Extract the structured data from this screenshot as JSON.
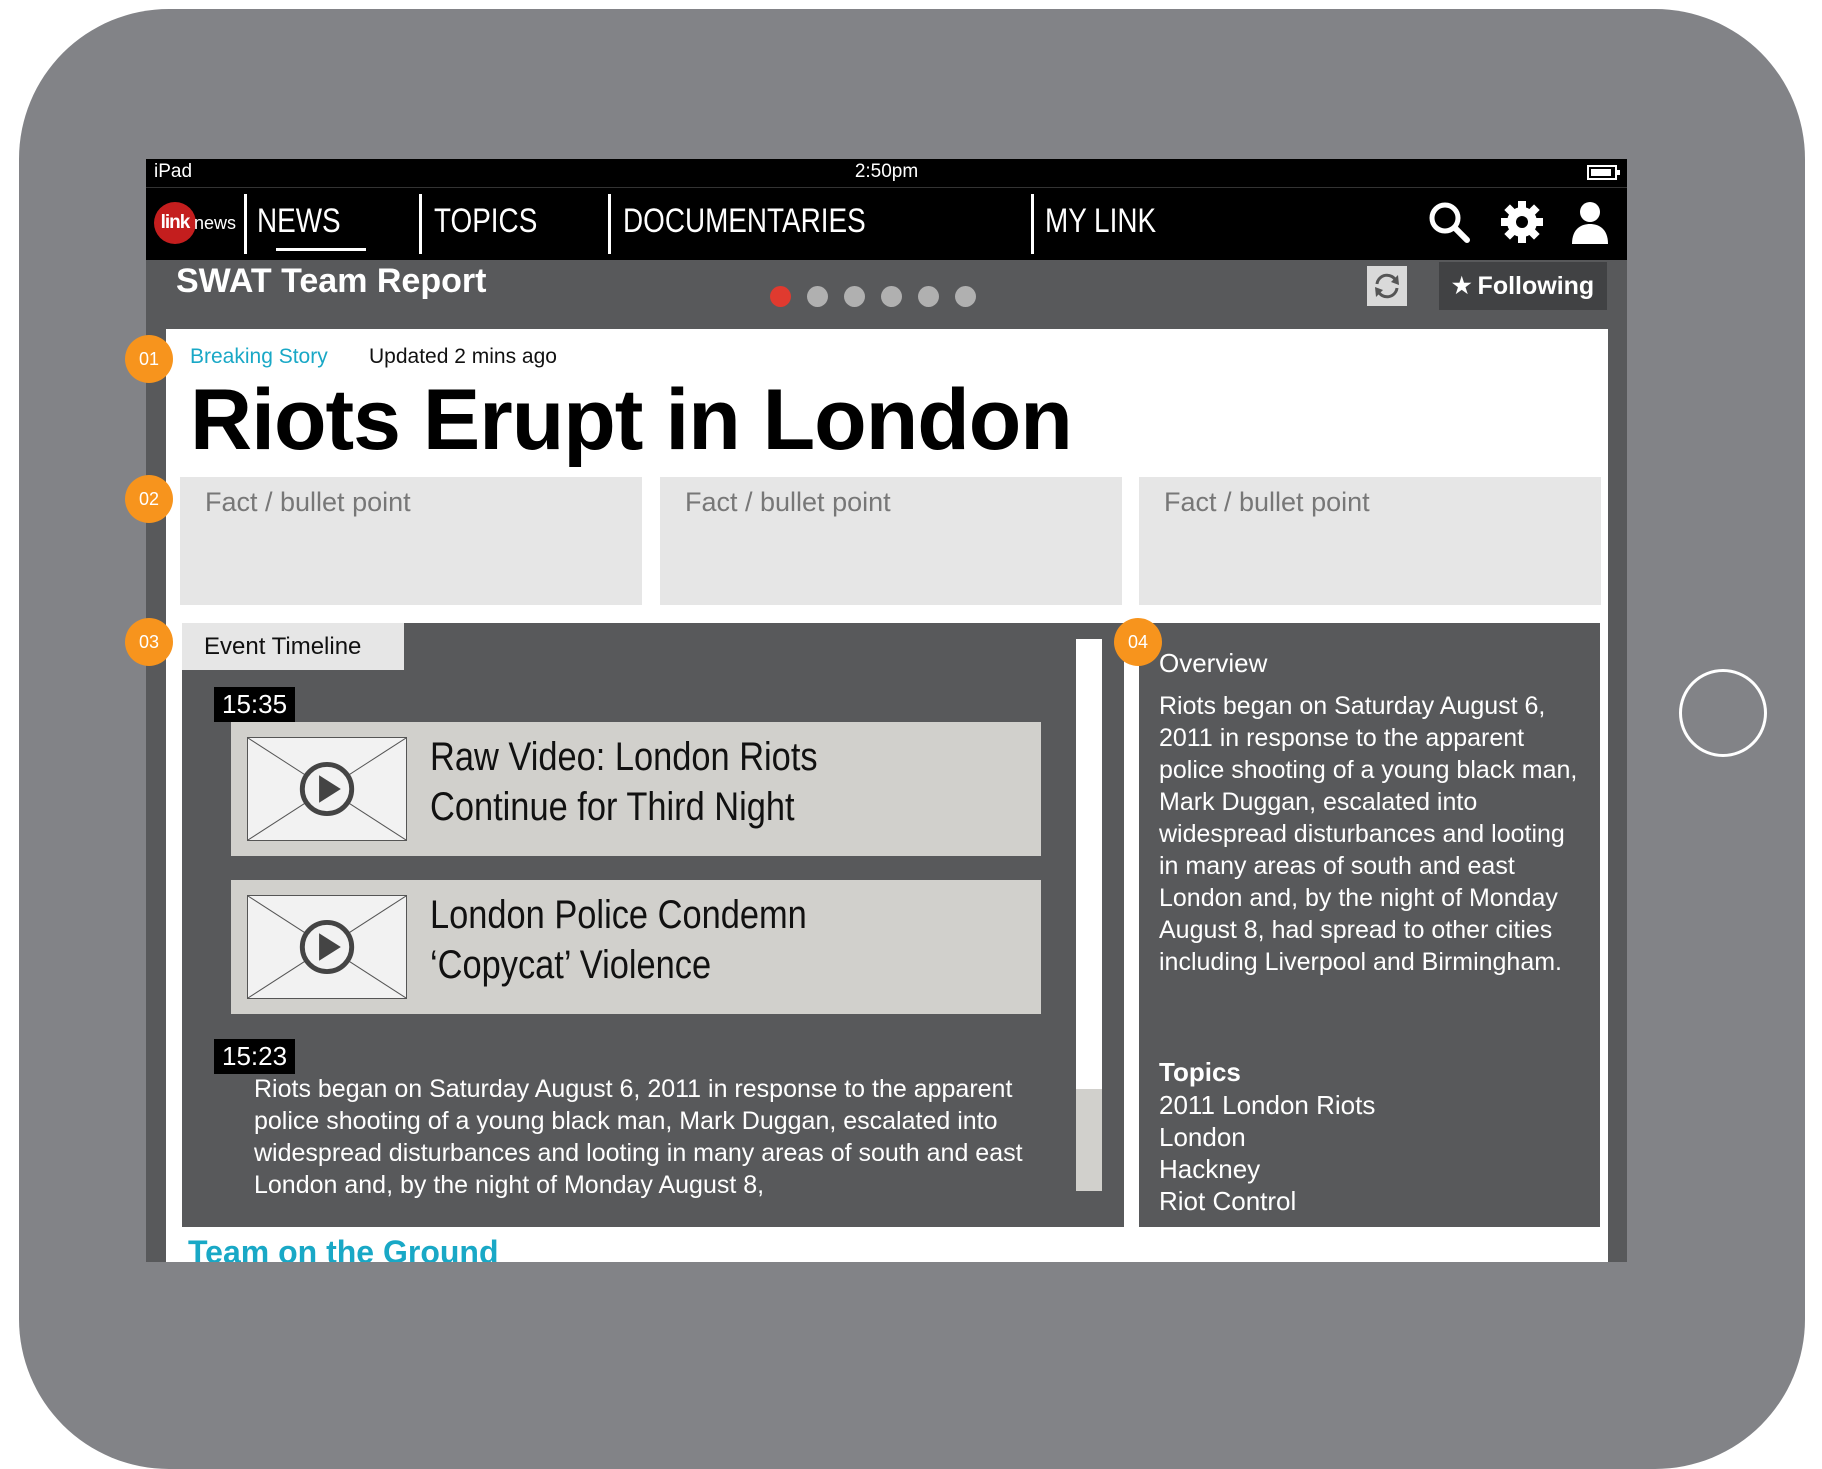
{
  "status_bar": {
    "device": "iPad",
    "time": "2:50pm"
  },
  "nav": {
    "logo_badge": "link",
    "logo_text": "news",
    "tabs": [
      "NEWS",
      "TOPICS",
      "DOCUMENTARIES",
      "MY LINK"
    ],
    "active_tab": "NEWS"
  },
  "subheader": {
    "title": "SWAT Team Report",
    "pagination": {
      "total": 6,
      "active": 1
    },
    "following_label": "Following"
  },
  "story": {
    "label": "Breaking Story",
    "updated": "Updated 2 mins ago",
    "headline": "Riots Erupt in London",
    "facts": [
      "Fact / bullet point",
      "Fact / bullet point",
      "Fact / bullet point"
    ]
  },
  "timeline": {
    "tab_label": "Event Timeline",
    "entries": [
      {
        "time": "15:35"
      },
      {
        "time": "15:23"
      }
    ],
    "videos": [
      {
        "title": "Raw Video: London Riots Continue for Third Night"
      },
      {
        "title": "London Police Condemn ‘Copycat’ Violence"
      }
    ],
    "text": "Riots began on Saturday August 6, 2011 in response to the apparent police shooting of a young black man, Mark Duggan, escalated into widespread disturbances and looting in many areas of south and east London and, by the night of Monday August 8,"
  },
  "overview": {
    "heading": "Overview",
    "text": "Riots began on Saturday August 6, 2011 in response to the apparent police shooting of a young black man, Mark Duggan, escalated into widespread disturbances and looting in many areas of south and east London and, by the night of Monday August 8, had spread to other cities including Liverpool and Birmingham.",
    "topics_heading": "Topics",
    "topics": [
      "2011 London Riots",
      "London",
      "Hackney",
      "Riot Control"
    ]
  },
  "team": {
    "heading": "Team on the Ground"
  },
  "annotations": [
    "01",
    "02",
    "03",
    "04"
  ],
  "colors": {
    "accent_cyan": "#19a8c6",
    "annotation_orange": "#f7941d",
    "active_dot": "#e03a2f",
    "logo_red": "#c41e1e"
  },
  "icons": [
    "search-icon",
    "gear-icon",
    "user-icon",
    "refresh-icon",
    "star-icon",
    "play-icon",
    "battery-icon"
  ]
}
